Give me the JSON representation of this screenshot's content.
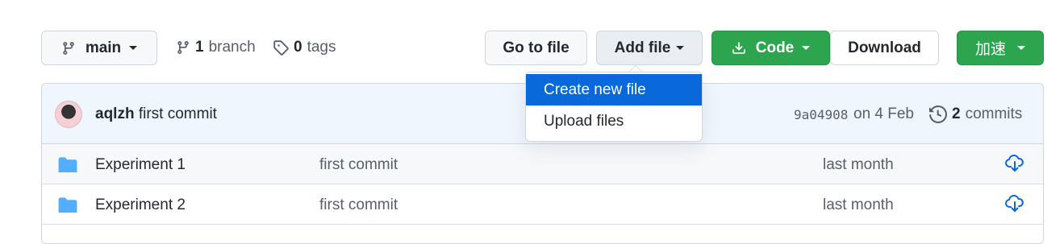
{
  "toolbar": {
    "branch_selector": "main",
    "branch_count": "1",
    "branch_word": "branch",
    "tag_count": "0",
    "tag_word": "tags",
    "go_to_file": "Go to file",
    "add_file": "Add file",
    "code": "Code",
    "download": "Download",
    "accelerate": "加速"
  },
  "add_file_menu": {
    "items": [
      {
        "label": "Create new file",
        "active": true
      },
      {
        "label": "Upload files",
        "active": false
      }
    ]
  },
  "latest_commit": {
    "author": "aqlzh",
    "message": "first commit",
    "sha": "9a04908",
    "date": "on 4 Feb",
    "commit_count": "2",
    "commit_word": "commits"
  },
  "files": [
    {
      "name": "Experiment 1",
      "message": "first commit",
      "age": "last month",
      "icon": "folder-icon"
    },
    {
      "name": "Experiment 2",
      "message": "first commit",
      "age": "last month",
      "icon": "folder-icon"
    }
  ],
  "colors": {
    "green": "#2da44e",
    "accent_blue": "#0969da",
    "folder": "#54aeff"
  }
}
